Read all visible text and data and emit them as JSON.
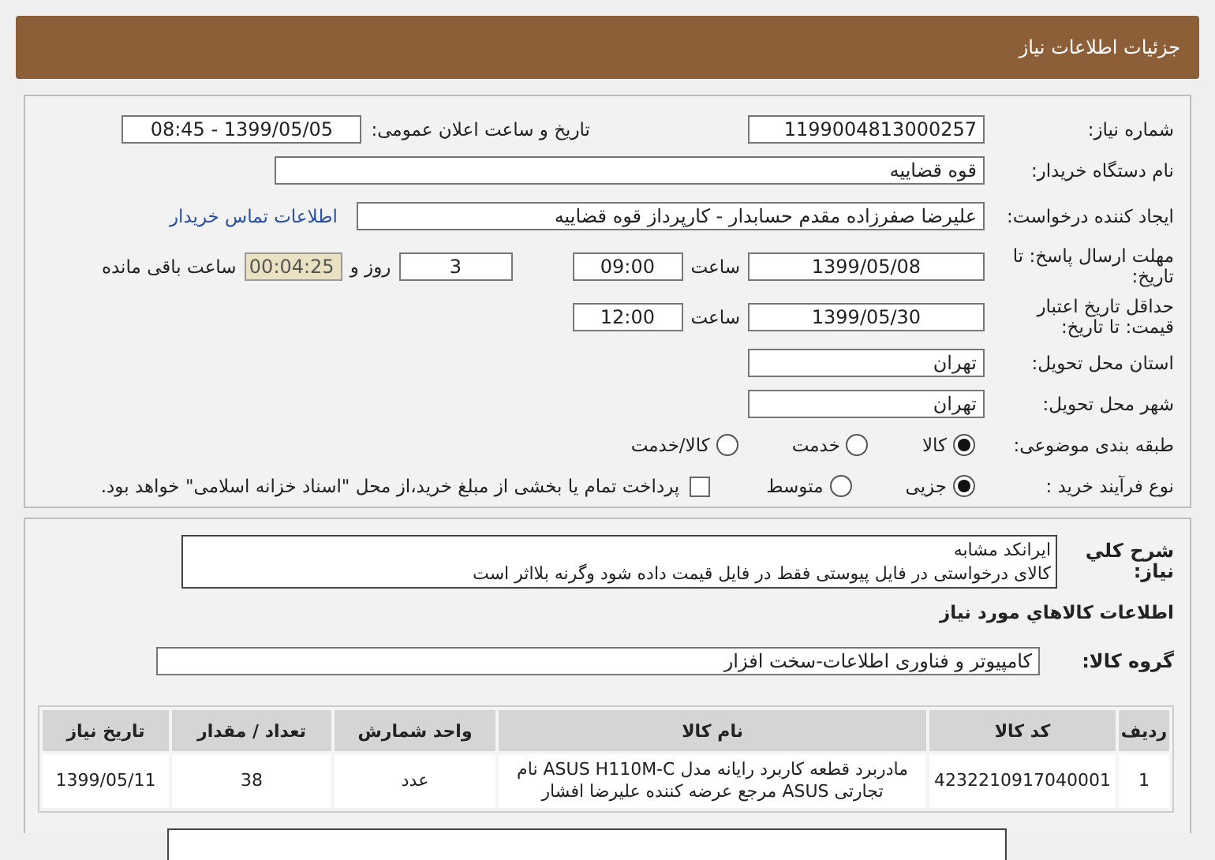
{
  "header": {
    "title": "جزئیات اطلاعات نیاز"
  },
  "need_number": {
    "label": "شماره نیاز:",
    "value": "1199004813000257"
  },
  "announce": {
    "label": "تاریخ و ساعت اعلان عمومی:",
    "value": "1399/05/05 - 08:45"
  },
  "buyer": {
    "label": "نام دستگاه خریدار:",
    "value": "قوه قضاییه"
  },
  "creator": {
    "label": "ایجاد کننده درخواست:",
    "value": "علیرضا  صفرزاده مقدم  حسابدار - کارپرداز قوه قضاییه",
    "link": "اطلاعات تماس خریدار"
  },
  "deadline": {
    "label": "مهلت ارسال پاسخ: تا تاریخ:",
    "date": "1399/05/08",
    "time_label": "ساعت",
    "time": "09:00",
    "days": "3",
    "days_label": "روز و",
    "remaining": "00:04:25",
    "remaining_label": "ساعت باقی مانده"
  },
  "validity": {
    "label": "حداقل تاریخ اعتبار قیمت: تا تاریخ:",
    "date": "1399/05/30",
    "time_label": "ساعت",
    "time": "12:00"
  },
  "province": {
    "label": "استان محل تحویل:",
    "value": "تهران"
  },
  "city": {
    "label": "شهر محل تحویل:",
    "value": "تهران"
  },
  "category": {
    "label": "طبقه بندی موضوعی:",
    "options": [
      {
        "label": "کالا",
        "selected": true
      },
      {
        "label": "خدمت",
        "selected": false
      },
      {
        "label": "کالا/خدمت",
        "selected": false
      }
    ]
  },
  "purchase_type": {
    "label": "نوع فرآیند خرید :",
    "options": [
      {
        "label": "جزیی",
        "selected": true
      },
      {
        "label": "متوسط",
        "selected": false
      }
    ],
    "payment_option": {
      "label": "پرداخت تمام یا بخشی از مبلغ خرید،از محل \"اسناد خزانه اسلامی\" خواهد بود.",
      "checked": false
    }
  },
  "description": {
    "label": "شرح کلي نياز:",
    "lines": [
      "ایرانکد مشابه",
      "کالای درخواستی در فایل پیوستی فقط در فایل قیمت داده شود وگرنه بلااثر است"
    ]
  },
  "items_heading": "اطلاعات کالاهاي مورد نياز",
  "goods_group": {
    "label": "گروه کالا:",
    "value": "کامپیوتر و فناوری اطلاعات-سخت افزار"
  },
  "table": {
    "columns": [
      "ردیف",
      "کد کالا",
      "نام کالا",
      "واحد شمارش",
      "تعداد / مقدار",
      "تاریخ نیاز"
    ],
    "rows": [
      [
        "1",
        "4232210917040001",
        "مادربرد قطعه کاربرد رایانه مدل ASUS H110M-C نام تجارتی ASUS مرجع عرضه کننده علیرضا افشار",
        "عدد",
        "38",
        "1399/05/11"
      ]
    ]
  }
}
